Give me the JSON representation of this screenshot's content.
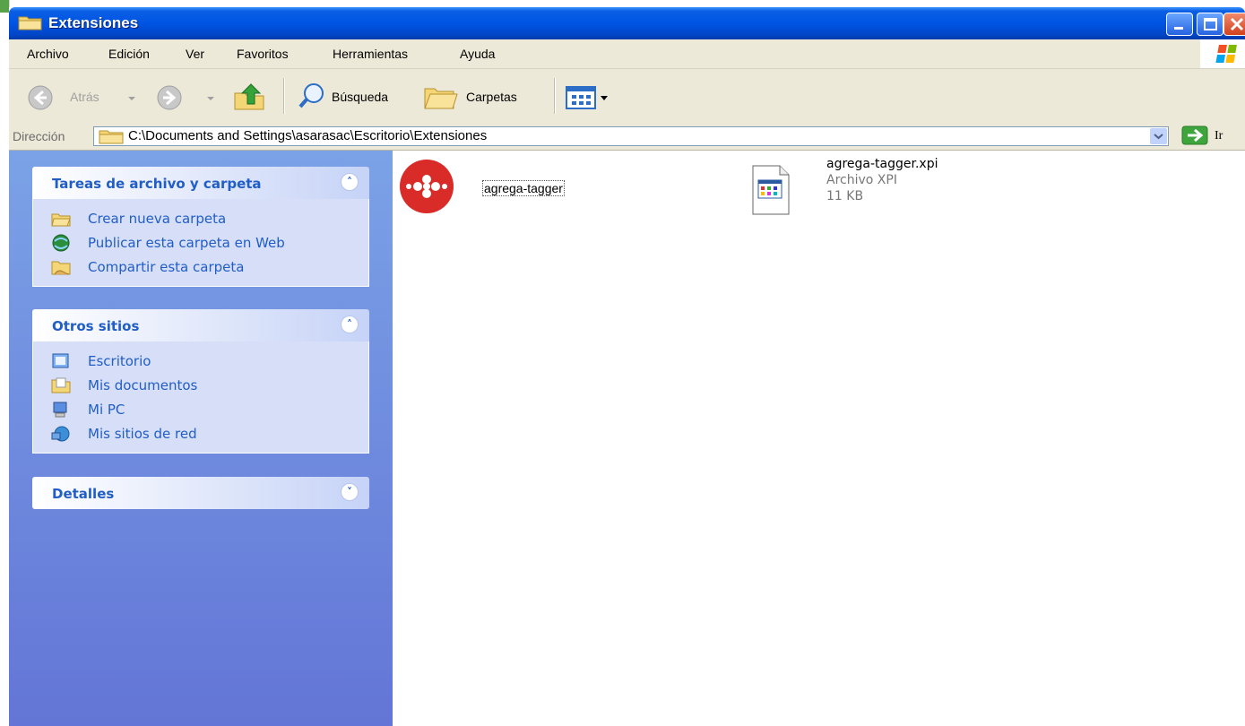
{
  "window": {
    "title": "Extensiones"
  },
  "menu": [
    "Archivo",
    "Edición",
    "Ver",
    "Favoritos",
    "Herramientas",
    "Ayuda"
  ],
  "toolbar": {
    "back_label": "Atrás",
    "search_label": "Búsqueda",
    "folders_label": "Carpetas"
  },
  "address": {
    "label": "Dirección",
    "path": "C:\\Documents and Settings\\asarasac\\Escritorio\\Extensiones",
    "go_label": "Ir"
  },
  "sidebar": {
    "file_tasks": {
      "title": "Tareas de archivo y carpeta",
      "items": [
        "Crear nueva carpeta",
        "Publicar esta carpeta en Web",
        "Compartir esta carpeta"
      ]
    },
    "other_places": {
      "title": "Otros sitios",
      "items": [
        "Escritorio",
        "Mis documentos",
        "Mi PC",
        "Mis sitios de red"
      ]
    },
    "details": {
      "title": "Detalles"
    }
  },
  "files": [
    {
      "name": "agrega-tagger"
    },
    {
      "name": "agrega-tagger.xpi",
      "type": "Archivo XPI",
      "size": "11 KB"
    }
  ],
  "colors": {
    "title_bar": "#0054e3",
    "sidebar_gradient_top": "#7ba2e7",
    "sidebar_gradient_bottom": "#6375d6",
    "link": "#215dc6",
    "file1_icon": "#d92b27"
  }
}
